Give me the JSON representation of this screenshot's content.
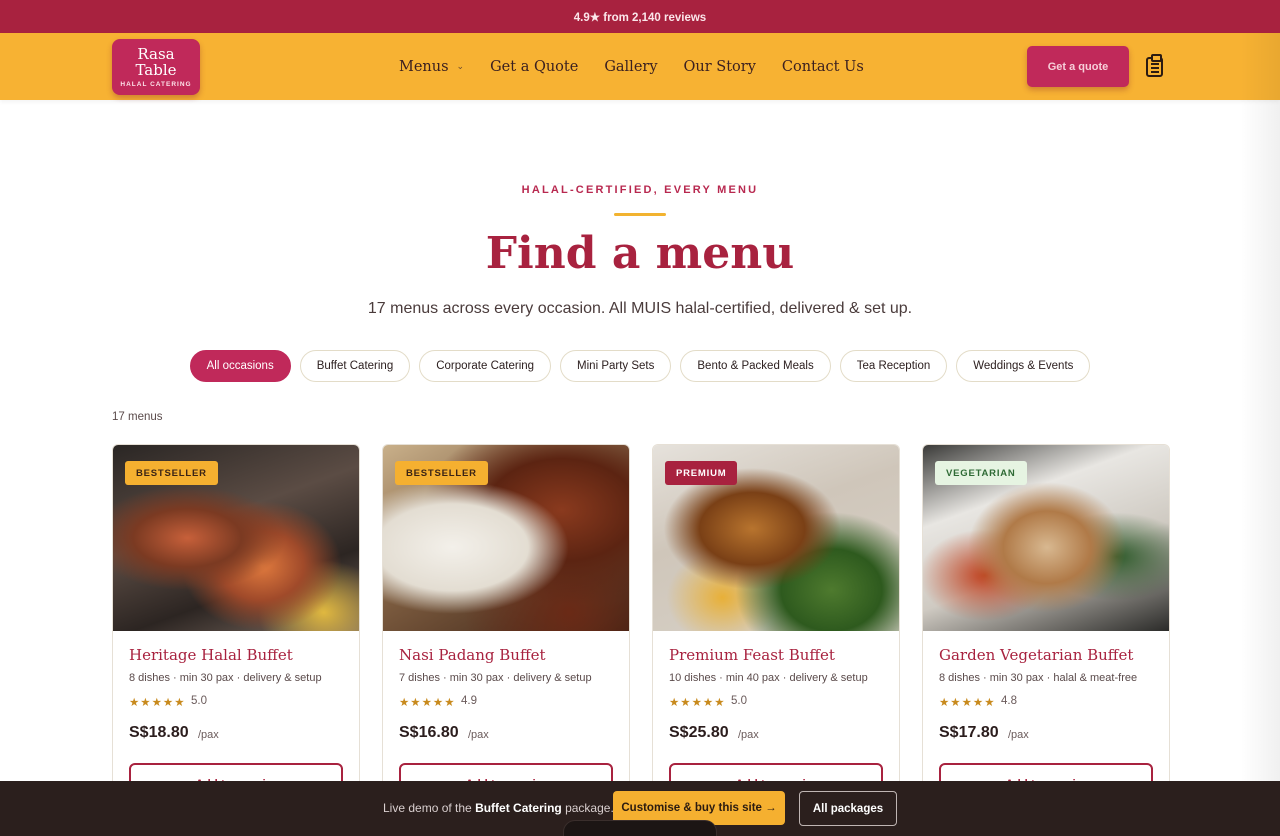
{
  "topbar": {
    "text": "4.9★ from 2,140 reviews"
  },
  "logo": {
    "line1": "Rasa",
    "line2": "Table",
    "tagline": "HALAL CATERING"
  },
  "nav": {
    "menus": "Menus",
    "quote": "Get a Quote",
    "gallery": "Gallery",
    "story": "Our Story",
    "contact": "Contact Us",
    "cta": "Get a quote"
  },
  "hero": {
    "eyebrow": "HALAL-CERTIFIED, EVERY MENU",
    "title": "Find a menu",
    "subtitle": "17 menus across every occasion. All MUIS halal-certified, delivered & set up."
  },
  "filters": [
    "All occasions",
    "Buffet Catering",
    "Corporate Catering",
    "Mini Party Sets",
    "Bento & Packed Meals",
    "Tea Reception",
    "Weddings & Events"
  ],
  "count": "17 menus",
  "cards": [
    {
      "badge": "BESTSELLER",
      "name": "Heritage Halal Buffet",
      "meta": "8 dishes · min 30 pax · delivery & setup",
      "stars": "★★★★★",
      "rating": "5.0",
      "price": "S$18.80",
      "per": "/pax",
      "cta": "Add to enquiry"
    },
    {
      "badge": "BESTSELLER",
      "name": "Nasi Padang Buffet",
      "meta": "7 dishes · min 30 pax · delivery & setup",
      "stars": "★★★★★",
      "rating": "4.9",
      "price": "S$16.80",
      "per": "/pax",
      "cta": "Add to enquiry"
    },
    {
      "badge": "PREMIUM",
      "name": "Premium Feast Buffet",
      "meta": "10 dishes · min 40 pax · delivery & setup",
      "stars": "★★★★★",
      "rating": "5.0",
      "price": "S$25.80",
      "per": "/pax",
      "cta": "Add to enquiry"
    },
    {
      "badge": "VEGETARIAN",
      "name": "Garden Vegetarian Buffet",
      "meta": "8 dishes · min 30 pax · halal & meat-free",
      "stars": "★★★★★",
      "rating": "4.8",
      "price": "S$17.80",
      "per": "/pax",
      "cta": "Add to enquiry"
    }
  ],
  "bottombar": {
    "prefix": "Live demo of the ",
    "package": "Buffet Catering",
    "suffix": " package.",
    "customise": "Customise & buy this site →",
    "all": "All packages"
  },
  "colors": {
    "brand": "#a8223f",
    "accent": "#c0295a",
    "gold": "#f7b233"
  },
  "icons": {
    "cart": "clipboard-icon",
    "chevron": "chevron-down-icon"
  }
}
